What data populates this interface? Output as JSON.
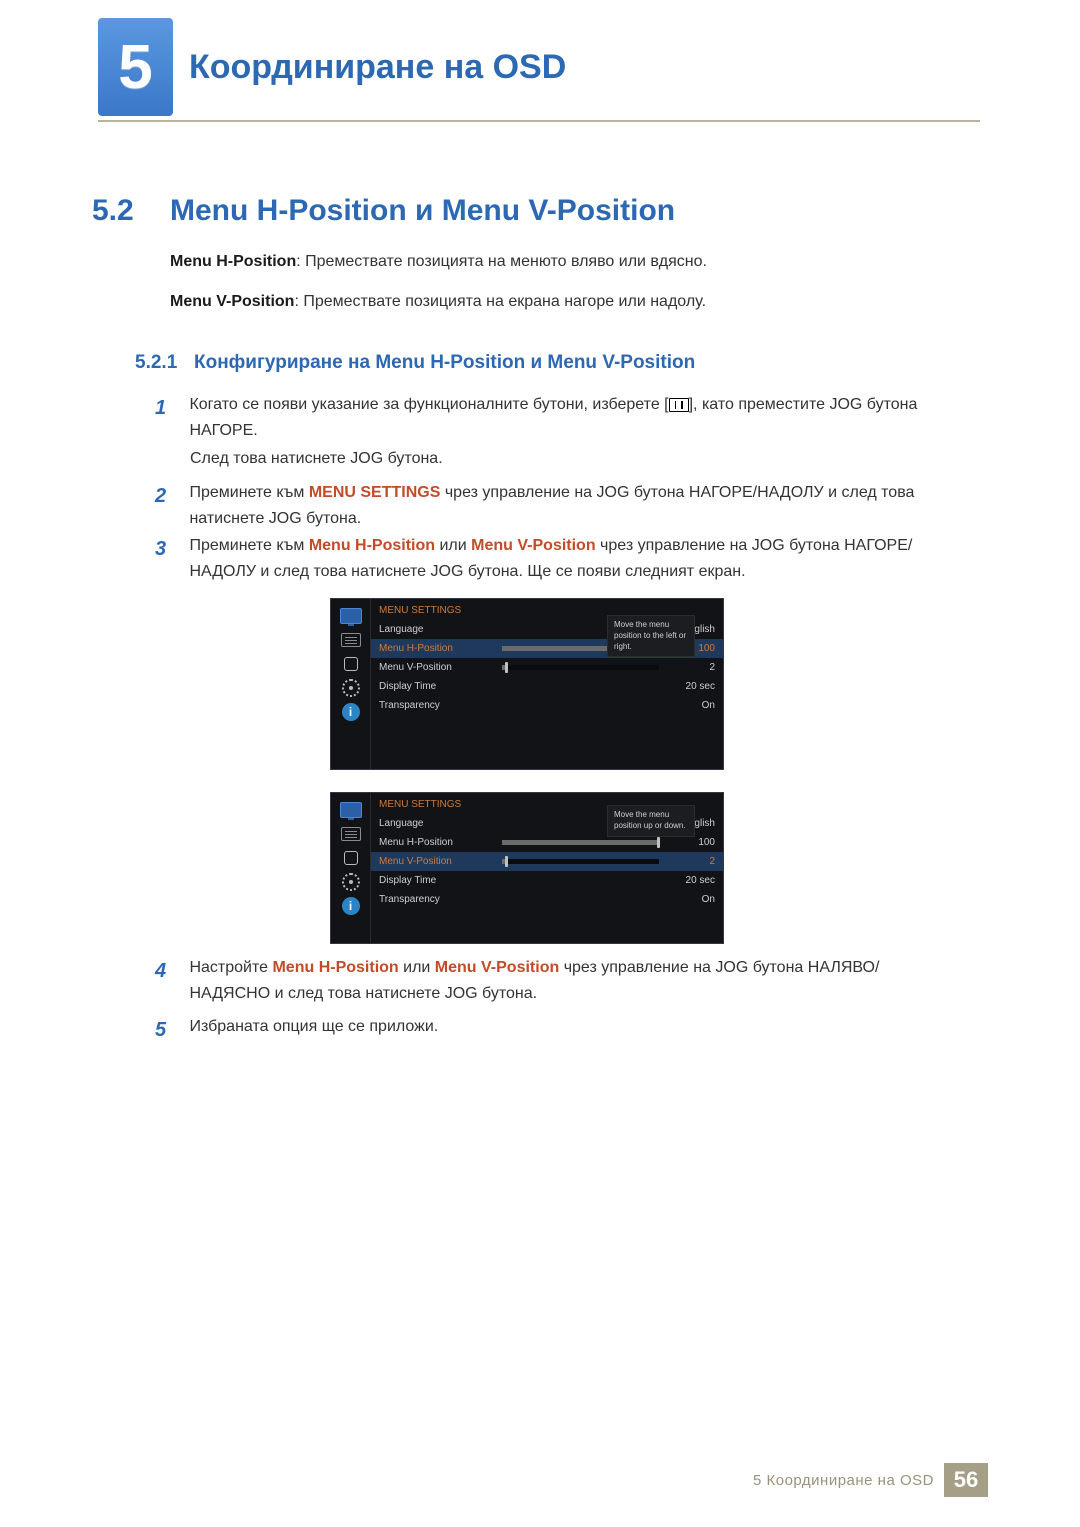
{
  "chapter": {
    "number": "5",
    "title": "Координиране на OSD"
  },
  "section": {
    "number": "5.2",
    "title": "Menu H-Position и Menu V-Position"
  },
  "intro": {
    "h_label": "Menu H-Position",
    "h_text": ": Премествате позицията на менюто вляво или вдясно.",
    "v_label": "Menu V-Position",
    "v_text": ": Премествате позицията на екрана нагоре или надолу."
  },
  "subsection": {
    "number": "5.2.1",
    "title": "Конфигуриране на Menu H-Position и Menu V-Position"
  },
  "steps": {
    "s1_pre": "Когато се появи указание за функционалните бутони, изберете [",
    "s1_post": "], като преместите JOG бутона НАГОРЕ.",
    "s1b": "След това натиснете JOG бутона.",
    "s2_pre": "Преминете към ",
    "s2_bold": "MENU SETTINGS",
    "s2_post": " чрез управление на JOG бутона НАГОРЕ/НАДОЛУ и след това натиснете JOG бутона.",
    "s3_pre": "Преминете към ",
    "s3_b1": "Menu H-Position",
    "s3_mid": " или ",
    "s3_b2": "Menu V-Position",
    "s3_post": " чрез управление на JOG бутона НАГОРЕ/НАДОЛУ и след това натиснете JOG бутона. Ще се появи следният екран.",
    "s4_pre": "Настройте ",
    "s4_b1": "Menu H-Position",
    "s4_mid": " или ",
    "s4_b2": "Menu V-Position",
    "s4_post": " чрез управление на JOG бутона НАЛЯВО/НАДЯСНО и след това натиснете JOG бутона.",
    "s5": "Избраната опция ще се приложи."
  },
  "osd": {
    "title": "MENU SETTINGS",
    "rows": {
      "language": {
        "label": "Language",
        "value": "English"
      },
      "hpos": {
        "label": "Menu H-Position",
        "value": "100"
      },
      "vpos": {
        "label": "Menu V-Position",
        "value": "2"
      },
      "display": {
        "label": "Display Time",
        "value": "20 sec"
      },
      "transparency": {
        "label": "Transparency",
        "value": "On"
      }
    },
    "help1": "Move the menu position to the left or right.",
    "help2": "Move the menu position up or down."
  },
  "footer": {
    "text": "5 Координиране на OSD",
    "page": "56"
  },
  "nums": {
    "n1": "1",
    "n2": "2",
    "n3": "3",
    "n4": "4",
    "n5": "5"
  },
  "info_i": "i"
}
